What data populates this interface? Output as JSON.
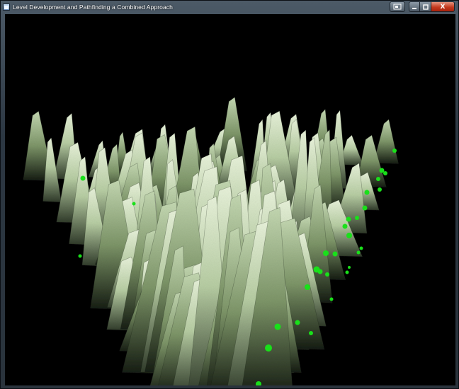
{
  "window": {
    "title": "Level Development and Pathfinding a Combined Approach",
    "controls": {
      "help_icon": "help-icon",
      "minimize_icon": "minimize-icon",
      "maximize_icon": "maximize-icon",
      "close_icon": "close-icon",
      "close_glyph": "X"
    }
  },
  "viewport": {
    "background": "#000000",
    "terrain_color_light": "#e3eed4",
    "terrain_color_mid": "#a9c194",
    "terrain_color_dark": "#3d4a35",
    "path_marker_color": "#19e01a"
  }
}
